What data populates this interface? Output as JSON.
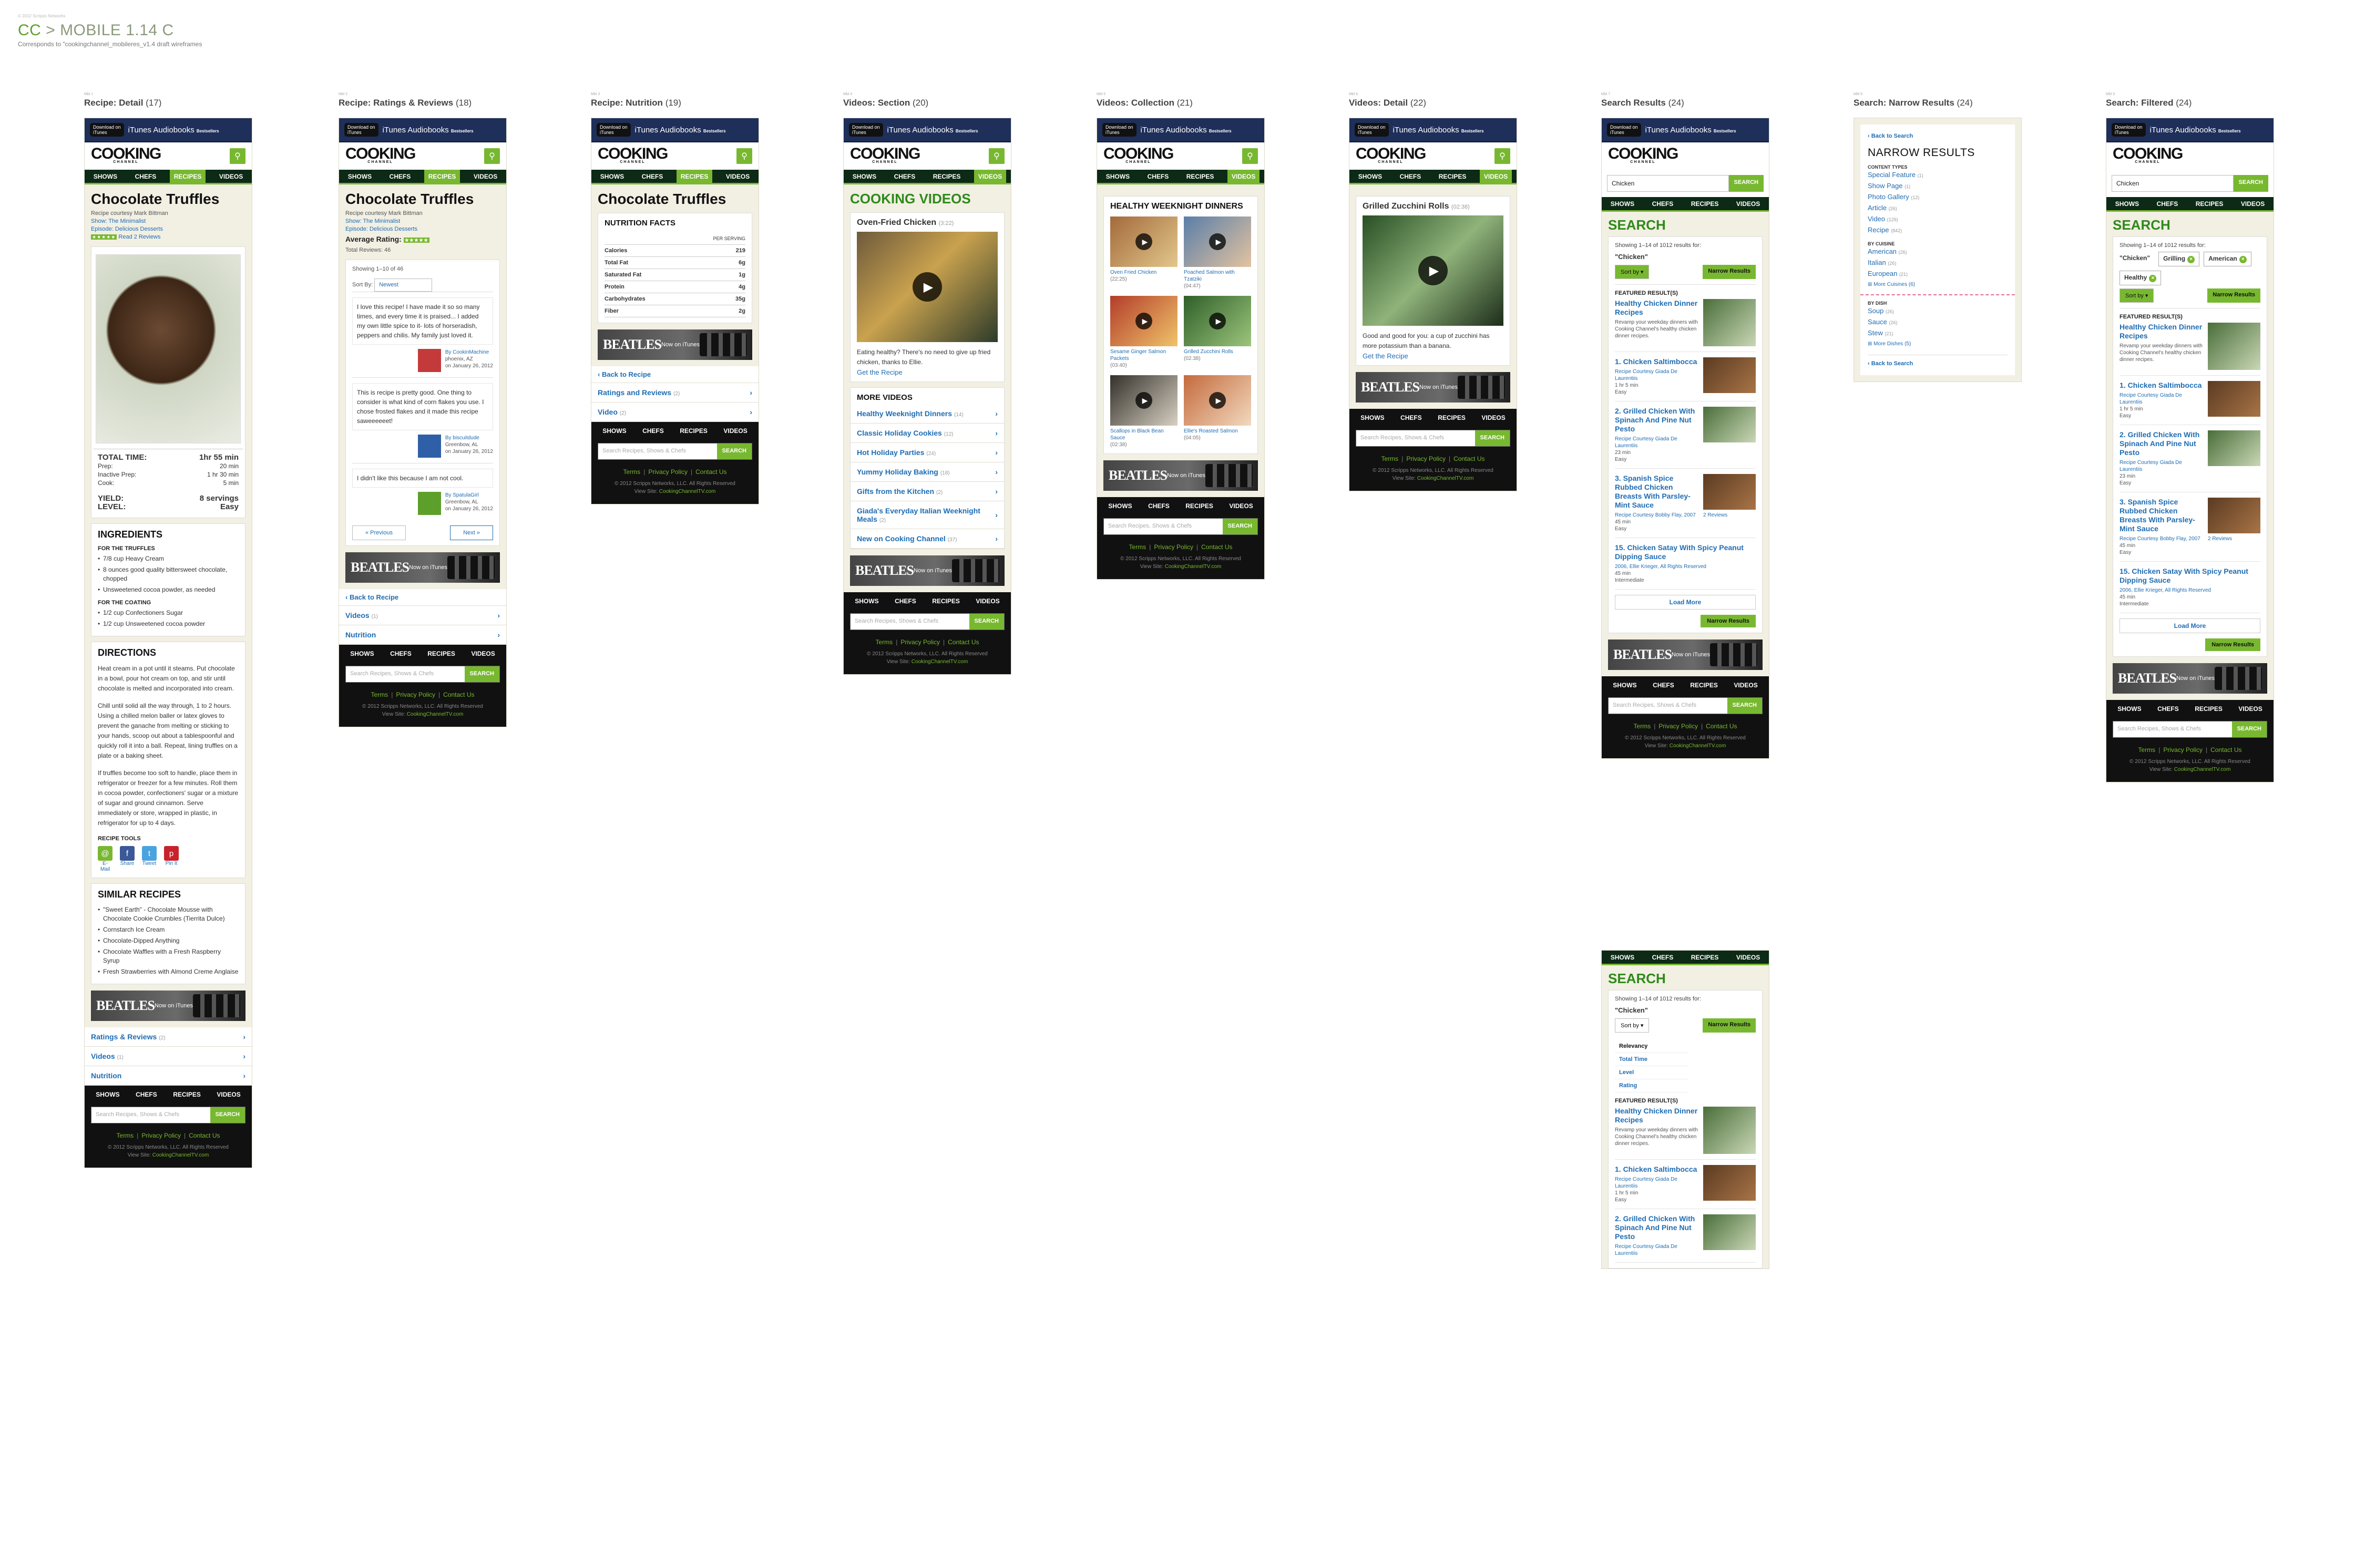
{
  "header": {
    "tiny": "© 2012 Scripps Networks",
    "project_code": "CC",
    "title": "MOBILE 1.14 C",
    "sep": ">",
    "subtitle": "Corresponds to \"cookingchannel_mobileres_v1.4 draft wireframes"
  },
  "common": {
    "banner_download": "Download on",
    "banner_itunes": "iTunes",
    "banner_audiobooks": "iTunes Audiobooks",
    "banner_bestsellers": "Bestsellers",
    "logo": "COOKING",
    "logo_sub": "CHANNEL",
    "nav": [
      "SHOWS",
      "CHEFS",
      "RECIPES",
      "VIDEOS"
    ],
    "ad_text": "BEATLES",
    "ad_sub": "Now on iTunes",
    "footer_placeholder": "Search Recipes, Shows & Chefs",
    "footer_search": "SEARCH",
    "footer_links": [
      "Terms",
      "Privacy Policy",
      "Contact Us"
    ],
    "copyright": "© 2012 Scripps Networks, LLC. All Rights Reserved",
    "view_site_label": "View Site:",
    "view_site_url": "CookingChannelTV.com"
  },
  "frames": {
    "f17": {
      "idx": "Mbl 1",
      "title": "Recipe: Detail",
      "num": "(17)",
      "recipe_title": "Chocolate Truffles",
      "courtesy": "Recipe courtesy Mark Bittman",
      "show": "Show: The Minimalist",
      "episode": "Episode: Delicious Desserts",
      "read_reviews": "Read 2 Reviews",
      "time": [
        {
          "k": "TOTAL TIME:",
          "v": "1hr 55 min"
        },
        {
          "k": "Prep:",
          "v": "20 min"
        },
        {
          "k": "Inactive Prep:",
          "v": "1 hr 30 min"
        },
        {
          "k": "Cook:",
          "v": "5 min"
        }
      ],
      "yield": {
        "k": "YIELD:",
        "v": "8 servings"
      },
      "level": {
        "k": "LEVEL:",
        "v": "Easy"
      },
      "ingredients_h": "INGREDIENTS",
      "for_truffles": "FOR THE TRUFFLES",
      "truffles": [
        "7/8 cup Heavy Cream",
        "8 ounces good quality bittersweet chocolate, chopped",
        "Unsweetened cocoa powder, as needed"
      ],
      "for_coating": "FOR THE COATING",
      "coating": [
        "1/2 cup Confectioners Sugar",
        "1/2 cup Unsweetened cocoa powder"
      ],
      "directions_h": "DIRECTIONS",
      "directions": [
        "Heat cream in a pot until it steams. Put chocolate in a bowl, pour hot cream on top, and stir until chocolate is melted and incorporated into cream.",
        "Chill until solid all the way through, 1 to 2 hours. Using a chilled melon baller or latex gloves to prevent the ganache from melting or sticking to your hands, scoop out about a tablespoonful and quickly roll it into a ball. Repeat, lining truffles on a plate or a baking sheet.",
        "If truffles become too soft to handle, place them in refrigerator or freezer for a few minutes. Roll them in cocoa powder, confectioners' sugar or a mixture of sugar and ground cinnamon. Serve immediately or store, wrapped in plastic, in refrigerator for up to 4 days."
      ],
      "tools_h": "RECIPE TOOLS",
      "tools": [
        "E-Mail",
        "Share",
        "Tweet",
        "Pin It"
      ],
      "similar_h": "SIMILAR RECIPES",
      "similar": [
        "\"Sweet Earth\" - Chocolate Mousse with Chocolate Cookie Crumbles (Tierrita Dulce)",
        "Cornstarch Ice Cream",
        "Chocolate-Dipped Anything",
        "Chocolate Waffles with a Fresh Raspberry Syrup",
        "Fresh Strawberries with Almond Creme Anglaise"
      ],
      "related": [
        {
          "l": "Ratings & Reviews",
          "c": "(2)"
        },
        {
          "l": "Videos",
          "c": "(1)"
        },
        {
          "l": "Nutrition",
          "c": ""
        }
      ]
    },
    "f18": {
      "idx": "Mbl 2",
      "title": "Recipe: Ratings & Reviews",
      "num": "(18)",
      "recipe_title": "Chocolate Truffles",
      "courtesy": "Recipe courtesy Mark Bittman",
      "show": "Show: The Minimalist",
      "episode": "Episode: Delicious Desserts",
      "avg": "Average Rating:",
      "total": "Total Reviews: 46",
      "showing": "Showing 1–10 of 46",
      "sort_by": "Sort By:",
      "sort_val": "Newest",
      "reviews": [
        {
          "text": "I love this recipe! I have made it so so many times, and every time it is praised... I added my own little spice to it- lots of horseradish, peppers and chilis. My family just loved it.",
          "by": "By CookinMachine",
          "loc": "phoenix, AZ",
          "date": "on January 26, 2012"
        },
        {
          "text": "This is recipe is pretty good. One thing to consider is what kind of corn flakes you use. I chose frosted flakes and it made this recipe saweeeeeet!",
          "by": "By biscuitdude",
          "loc": "Greenbow, AL",
          "date": "on January 26, 2012"
        },
        {
          "text": "I didn't like this because I am not cool.",
          "by": "By SpatulaGirl",
          "loc": "Greenbow, AL",
          "date": "on January 26, 2012"
        }
      ],
      "prev": "« Previous",
      "next": "Next »",
      "back": "Back to Recipe",
      "related": [
        {
          "l": "Videos",
          "c": "(1)"
        },
        {
          "l": "Nutrition",
          "c": ""
        }
      ]
    },
    "f19": {
      "idx": "Mbl 3",
      "title": "Recipe: Nutrition",
      "num": "(19)",
      "recipe_title": "Chocolate Truffles",
      "nf_h": "NUTRITION FACTS",
      "per": "PER SERVING",
      "rows": [
        {
          "k": "Calories",
          "v": "219"
        },
        {
          "k": "Total Fat",
          "v": "6g"
        },
        {
          "k": "Saturated Fat",
          "v": "1g"
        },
        {
          "k": "Protein",
          "v": "4g"
        },
        {
          "k": "Carbohydrates",
          "v": "35g"
        },
        {
          "k": "Fiber",
          "v": "2g"
        }
      ],
      "back": "Back to Recipe",
      "related": [
        {
          "l": "Ratings and Reviews",
          "c": "(2)"
        },
        {
          "l": "Video",
          "c": "(2)"
        }
      ]
    },
    "f20": {
      "idx": "Mbl 4",
      "title": "Videos: Section",
      "num": "(20)",
      "heading": "COOKING VIDEOS",
      "feat_title": "Oven-Fried Chicken",
      "feat_dur": "(3:22)",
      "feat_desc": "Eating healthy? There's no need to give up fried chicken, thanks to Ellie.",
      "feat_link": "Get the Recipe",
      "more_h": "MORE VIDEOS",
      "more": [
        {
          "l": "Healthy Weeknight Dinners",
          "c": "(14)"
        },
        {
          "l": "Classic Holiday Cookies",
          "c": "(12)"
        },
        {
          "l": "Hot Holiday Parties",
          "c": "(24)"
        },
        {
          "l": "Yummy Holiday Baking",
          "c": "(18)"
        },
        {
          "l": "Gifts from the Kitchen",
          "c": "(2)"
        },
        {
          "l": "Giada's Everyday Italian Weeknight Meals",
          "c": "(2)"
        },
        {
          "l": "New on Cooking Channel",
          "c": "(37)"
        }
      ]
    },
    "f21": {
      "idx": "Mbl 5",
      "title": "Videos: Collection",
      "num": "(21)",
      "heading": "HEALTHY WEEKNIGHT DINNERS",
      "items": [
        {
          "l": "Oven Fried Chicken",
          "d": "(22:25)"
        },
        {
          "l": "Poached Salmon with Tzatziki",
          "d": "(04:47)"
        },
        {
          "l": "Sesame Ginger Salmon Packets",
          "d": "(03:40)"
        },
        {
          "l": "Grilled Zucchini Rolls",
          "d": "(02:38)"
        },
        {
          "l": "Scallops in Black Bean Sauce",
          "d": "(02:38)"
        },
        {
          "l": "Ellie's Roasted Salmon",
          "d": "(04:05)"
        }
      ]
    },
    "f22": {
      "idx": "Mbl 6",
      "title": "Videos: Detail",
      "num": "(22)",
      "vtitle": "Grilled Zucchini Rolls",
      "vdur": "(02:38)",
      "desc": "Good and good for you: a cup of zucchini has more potassium than a banana.",
      "link": "Get the Recipe"
    },
    "f24": {
      "idx": "Mbl 7",
      "title": "Search Results",
      "num": "(24)",
      "query": "Chicken",
      "search_btn": "SEARCH",
      "heading": "SEARCH",
      "showing": "Showing 1–14 of 1012 results for:",
      "q": "\"Chicken\"",
      "sort": "Sort by",
      "narrow_btn": "Narrow Results",
      "featured_h": "FEATURED RESULT(S)",
      "featured_t": "Healthy Chicken Dinner Recipes",
      "featured_d": "Revamp your weekday dinners with Cooking Channel's healthy chicken dinner recipes.",
      "results": [
        {
          "t": "1. Chicken Saltimbocca",
          "d": "Recipe Courtesy Giada De Laurentiis",
          "x1": "1 hr 5 min",
          "x2": "Easy"
        },
        {
          "t": "2. Grilled Chicken With Spinach And Pine Nut Pesto",
          "d": "Recipe Courtesy Giada De Laurentiis",
          "x1": "23 min",
          "x2": "Easy"
        },
        {
          "t": "3. Spanish Spice Rubbed Chicken Breasts With Parsley-Mint Sauce",
          "d": "Recipe Courtesy Bobby Flay, 2007",
          "x1": "45 min",
          "x2": "Easy"
        },
        {
          "t": "15. Chicken Satay With Spicy Peanut Dipping Sauce",
          "d": "2006, Ellie Krieger, All Rights Reserved",
          "x1": "45 min",
          "x2": "Intermediate"
        }
      ],
      "reviews_link": "2 Reviews",
      "load_more": "Load More"
    },
    "f24b": {
      "idx": "Mbl 8",
      "title": "Search: Narrow Results",
      "num": "(24)",
      "back": "Back to Search",
      "heading": "NARROW RESULTS",
      "ct_h": "CONTENT TYPES",
      "ct": [
        {
          "l": "Special Feature",
          "c": "(1)"
        },
        {
          "l": "Show Page",
          "c": "(1)"
        },
        {
          "l": "Photo Gallery",
          "c": "(12)"
        },
        {
          "l": "Article",
          "c": "(26)"
        },
        {
          "l": "Video",
          "c": "(129)"
        },
        {
          "l": "Recipe",
          "c": "(842)"
        }
      ],
      "cuisine_h": "BY CUISINE",
      "cuisine": [
        {
          "l": "American",
          "c": "(26)"
        },
        {
          "l": "Italian",
          "c": "(26)"
        },
        {
          "l": "European",
          "c": "(21)"
        }
      ],
      "more_cuisines": "More Cuisines (6)",
      "dish_h": "BY DISH",
      "dish": [
        {
          "l": "Soup",
          "c": "(26)"
        },
        {
          "l": "Sauce",
          "c": "(26)"
        },
        {
          "l": "Stew",
          "c": "(21)"
        }
      ],
      "more_dishes": "More Dishes (5)"
    },
    "f24c": {
      "idx": "Mbl 9",
      "title": "Search: Filtered",
      "num": "(24)",
      "chips": [
        "\"Chicken\"",
        "Grilling",
        "American",
        "Healthy"
      ]
    },
    "f24d": {
      "sort_options": [
        "Relevancy",
        "Total Time",
        "Level",
        "Rating"
      ]
    }
  }
}
